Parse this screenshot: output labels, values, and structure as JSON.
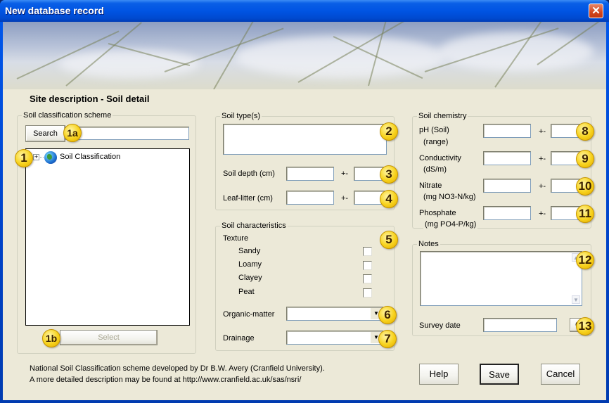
{
  "window": {
    "title": "New database record",
    "close_icon": "close-icon"
  },
  "heading": "Site description - Soil detail",
  "classification": {
    "legend": "Soil classification scheme",
    "search_label": "Search",
    "search_value": "",
    "tree_items": [
      {
        "label": "Soil Classification",
        "icon": "globe-icon",
        "expander": "+"
      }
    ],
    "select_label": "Select",
    "badges": {
      "tree": "1",
      "search": "1a",
      "select": "1b"
    }
  },
  "soil_types": {
    "legend": "Soil type(s)",
    "value": "",
    "depth_label": "Soil depth (cm)",
    "litter_label": "Leaf-litter (cm)",
    "plusminus": "+-",
    "badges": {
      "types": "2",
      "depth": "3",
      "litter": "4"
    }
  },
  "characteristics": {
    "legend": "Soil characteristics",
    "texture_label": "Texture",
    "textures": [
      {
        "label": "Sandy",
        "checked": false
      },
      {
        "label": "Loamy",
        "checked": false
      },
      {
        "label": "Clayey",
        "checked": false
      },
      {
        "label": "Peat",
        "checked": false
      }
    ],
    "organic_label": "Organic-matter",
    "organic_value": "",
    "drainage_label": "Drainage",
    "drainage_value": "",
    "badges": {
      "texture": "5",
      "organic": "6",
      "drainage": "7"
    }
  },
  "chemistry": {
    "legend": "Soil chemistry",
    "rows": [
      {
        "label": "pH (Soil)",
        "unit": "(range)",
        "badge": "8"
      },
      {
        "label": "Conductivity",
        "unit": "(dS/m)",
        "badge": "9"
      },
      {
        "label": "Nitrate",
        "unit": "(mg NO3-N/kg)",
        "badge": "10"
      },
      {
        "label": "Phosphate",
        "unit": "(mg PO4-P/kg)",
        "badge": "11"
      }
    ],
    "plusminus": "+-"
  },
  "notes": {
    "legend": "Notes",
    "value": "",
    "survey_date_label": "Survey date",
    "survey_date_value": "",
    "calendar_button": "C",
    "badges": {
      "notes": "12",
      "date": "13"
    }
  },
  "footer": {
    "line1": "National Soil Classification scheme developed by Dr B.W. Avery (Cranfield University).",
    "line2": "A more detailed description may be found at http://www.cranfield.ac.uk/sas/nsri/"
  },
  "buttons": {
    "help": "Help",
    "save": "Save",
    "cancel": "Cancel"
  }
}
